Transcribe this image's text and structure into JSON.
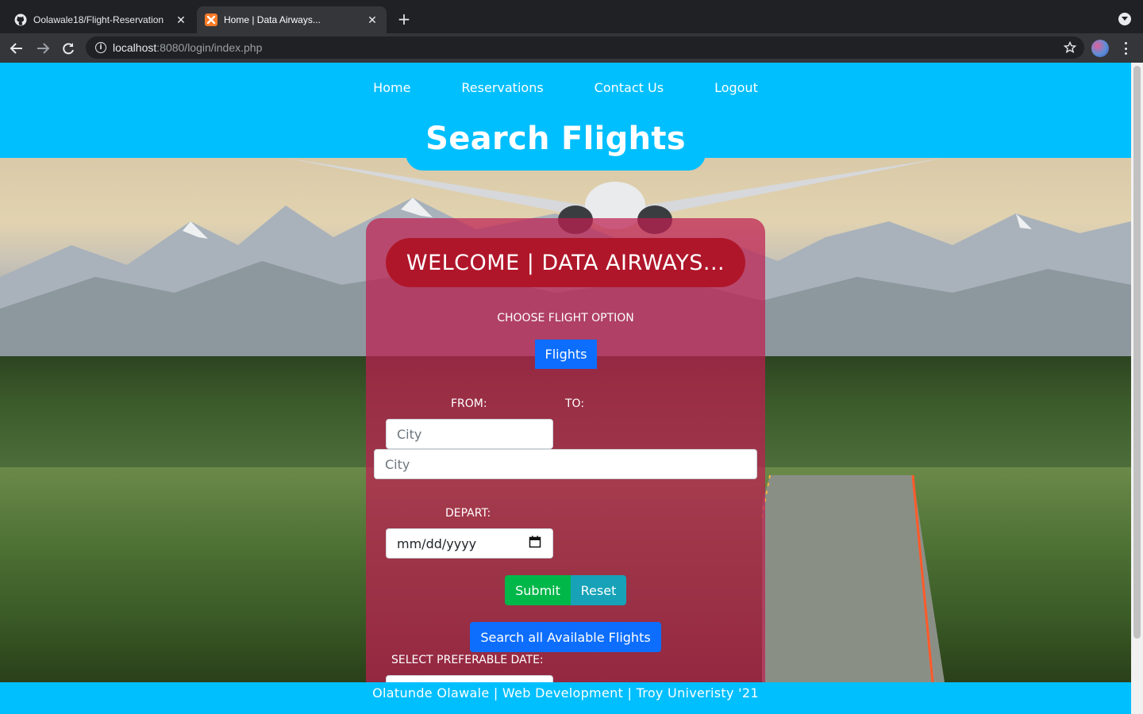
{
  "browser": {
    "tabs": [
      {
        "title": "Oolawale18/Flight-Reservation",
        "favicon": "github-icon"
      },
      {
        "title": "Home | Data Airways...",
        "favicon": "xampp-icon"
      }
    ],
    "url_host": "localhost",
    "url_rest": ":8080/login/index.php"
  },
  "nav": {
    "home": "Home",
    "reservations": "Reservations",
    "contact": "Contact Us",
    "logout": "Logout"
  },
  "page_title": "Search Flights",
  "form": {
    "welcome": "WELCOME | DATA AIRWAYS...",
    "choose_option": "CHOOSE FLIGHT OPTION",
    "flights_button": "Flights",
    "from_label": "FROM:",
    "to_label": "TO:",
    "from_placeholder": "City",
    "to_placeholder": "City",
    "depart_label": "DEPART:",
    "date_placeholder": "mm/dd/yyyy",
    "submit": "Submit",
    "reset": "Reset",
    "search_all": "Search all Available Flights",
    "preferable_date_label": "SELECT PREFERABLE DATE:"
  },
  "footer": "Olatunde Olawale | Web Development | Troy Univeristy '21",
  "colors": {
    "header": "#00bfff",
    "card": "#be1e50",
    "welcome_pill": "#b0162a",
    "primary_button": "#0d6efd",
    "submit_button": "#00b74a",
    "reset_button": "#17a2b8"
  }
}
